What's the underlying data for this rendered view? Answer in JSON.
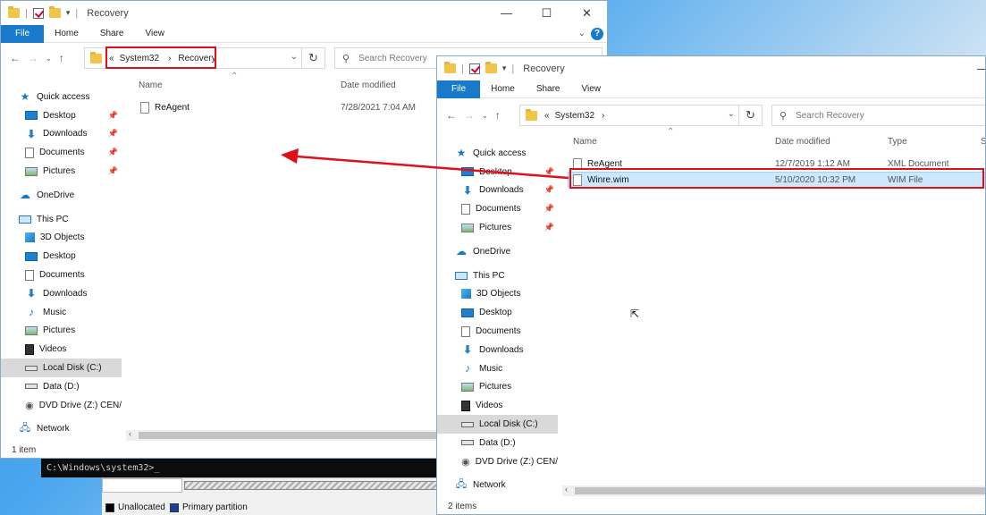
{
  "left_window": {
    "title": "Recovery",
    "ribbon_tabs": [
      "File",
      "Home",
      "Share",
      "View"
    ],
    "address": {
      "prefix": "«",
      "part1": "System32",
      "sep": "›",
      "part2": "Recovery"
    },
    "search_placeholder": "Search Recovery",
    "columns": {
      "name": "Name",
      "date": "Date modified"
    },
    "nav_items": [
      {
        "label": "Quick access",
        "icon": "star-icon"
      },
      {
        "label": "Desktop",
        "icon": "desktop-icon",
        "pinned": true
      },
      {
        "label": "Downloads",
        "icon": "download-icon",
        "pinned": true
      },
      {
        "label": "Documents",
        "icon": "document-icon",
        "pinned": true
      },
      {
        "label": "Pictures",
        "icon": "pictures-icon",
        "pinned": true
      },
      {
        "label": "OneDrive",
        "icon": "cloud-icon"
      },
      {
        "label": "This PC",
        "icon": "computer-icon"
      },
      {
        "label": "3D Objects",
        "icon": "cube-icon"
      },
      {
        "label": "Desktop",
        "icon": "desktop-icon"
      },
      {
        "label": "Documents",
        "icon": "document-icon"
      },
      {
        "label": "Downloads",
        "icon": "download-icon"
      },
      {
        "label": "Music",
        "icon": "music-icon"
      },
      {
        "label": "Pictures",
        "icon": "pictures-icon"
      },
      {
        "label": "Videos",
        "icon": "video-icon"
      },
      {
        "label": "Local Disk (C:)",
        "icon": "disk-icon",
        "selected": true
      },
      {
        "label": "Data (D:)",
        "icon": "disk-icon"
      },
      {
        "label": "DVD Drive (Z:) CEN/",
        "icon": "dvd-icon"
      },
      {
        "label": "Network",
        "icon": "network-icon"
      }
    ],
    "files": [
      {
        "name": "ReAgent",
        "date": "7/28/2021 7:04 AM"
      }
    ],
    "status": "1 item"
  },
  "right_window": {
    "title": "Recovery",
    "ribbon_tabs": [
      "File",
      "Home",
      "Share",
      "View"
    ],
    "address": {
      "prefix": "«",
      "part1": "System32",
      "sep": "›"
    },
    "search_placeholder": "Search Recovery",
    "columns": {
      "name": "Name",
      "date": "Date modified",
      "type": "Type",
      "size": "S"
    },
    "nav_items": [
      {
        "label": "Quick access",
        "icon": "star-icon"
      },
      {
        "label": "Desktop",
        "icon": "desktop-icon",
        "pinned": true
      },
      {
        "label": "Downloads",
        "icon": "download-icon",
        "pinned": true
      },
      {
        "label": "Documents",
        "icon": "document-icon",
        "pinned": true
      },
      {
        "label": "Pictures",
        "icon": "pictures-icon",
        "pinned": true
      },
      {
        "label": "OneDrive",
        "icon": "cloud-icon"
      },
      {
        "label": "This PC",
        "icon": "computer-icon"
      },
      {
        "label": "3D Objects",
        "icon": "cube-icon"
      },
      {
        "label": "Desktop",
        "icon": "desktop-icon"
      },
      {
        "label": "Documents",
        "icon": "document-icon"
      },
      {
        "label": "Downloads",
        "icon": "download-icon"
      },
      {
        "label": "Music",
        "icon": "music-icon"
      },
      {
        "label": "Pictures",
        "icon": "pictures-icon"
      },
      {
        "label": "Videos",
        "icon": "video-icon"
      },
      {
        "label": "Local Disk (C:)",
        "icon": "disk-icon",
        "selected": true
      },
      {
        "label": "Data (D:)",
        "icon": "disk-icon"
      },
      {
        "label": "DVD Drive (Z:) CEN/",
        "icon": "dvd-icon"
      },
      {
        "label": "Network",
        "icon": "network-icon"
      }
    ],
    "files": [
      {
        "name": "ReAgent",
        "date": "12/7/2019 1:12 AM",
        "type": "XML Document"
      },
      {
        "name": "Winre.wim",
        "date": "5/10/2020 10:32 PM",
        "type": "WIM File",
        "selected": true
      }
    ],
    "status": "2 items"
  },
  "cmd_prompt": "C:\\Windows\\system32>_",
  "disk_legend": {
    "unallocated": "Unallocated",
    "primary": "Primary partition"
  },
  "colors": {
    "accent": "#1979ca",
    "highlight": "#e0101a",
    "selection": "#cce8ff"
  }
}
